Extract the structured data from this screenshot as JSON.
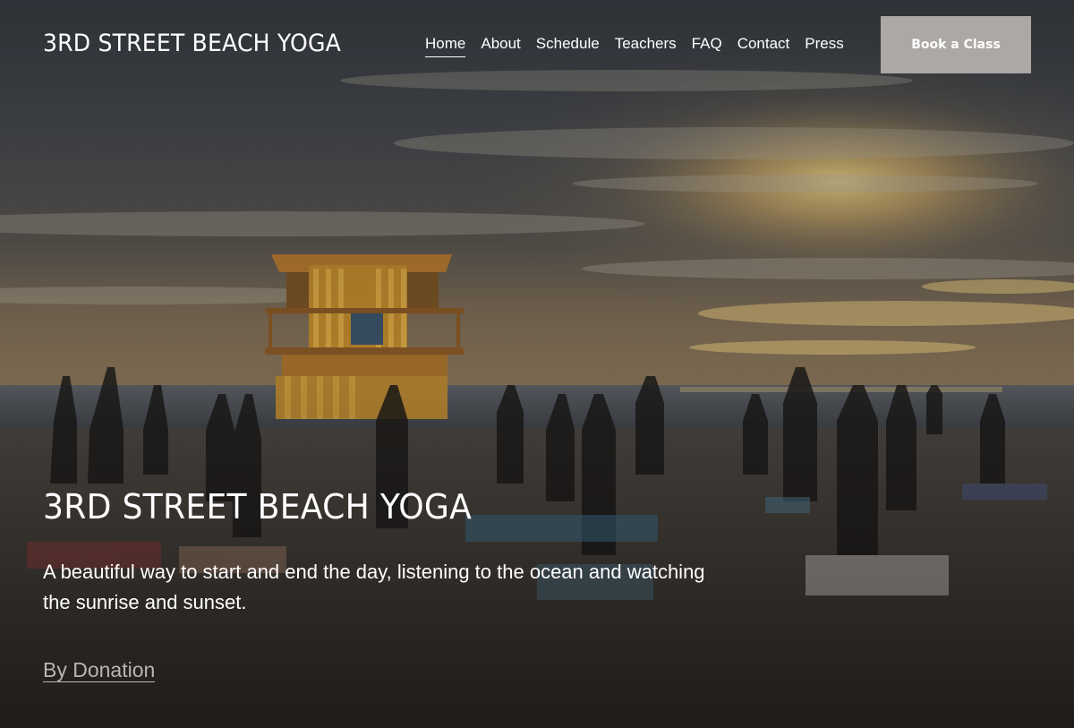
{
  "site": {
    "title": "3RD STREET BEACH YOGA"
  },
  "nav": {
    "items": [
      {
        "label": "Home",
        "active": true
      },
      {
        "label": "About",
        "active": false
      },
      {
        "label": "Schedule",
        "active": false
      },
      {
        "label": "Teachers",
        "active": false
      },
      {
        "label": "FAQ",
        "active": false
      },
      {
        "label": "Contact",
        "active": false
      },
      {
        "label": "Press",
        "active": false
      }
    ],
    "cta_label": "Book a Class"
  },
  "hero": {
    "heading": "3RD STREET BEACH YOGA",
    "subtitle": "A beautiful way to start and end the day, listening to the ocean and watching the sunrise and sunset.",
    "link_label": "By Donation",
    "image_subject": "beach-yoga-class-at-sunset-with-lifeguard-tower"
  },
  "colors": {
    "cta_background": "#aca8a3",
    "link_color": "#b9b6b1",
    "text": "#ffffff"
  }
}
